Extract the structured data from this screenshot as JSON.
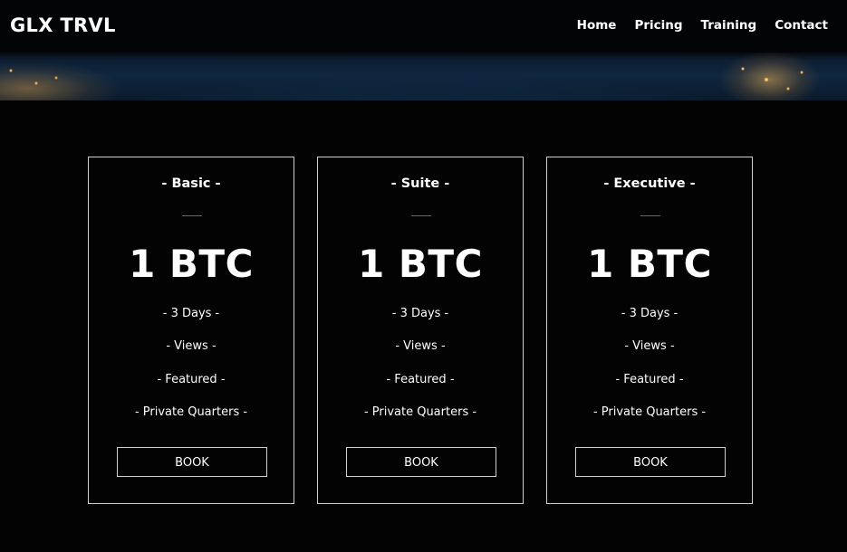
{
  "navbar": {
    "brand": "GLX TRVL",
    "links": [
      "Home",
      "Pricing",
      "Training",
      "Contact"
    ]
  },
  "plans": [
    {
      "title": "- Basic -",
      "price": "1 BTC",
      "features": [
        "- 3 Days -",
        "- Views -",
        "- Featured -",
        "- Private Quarters -"
      ],
      "button": "BOOK"
    },
    {
      "title": "- Suite -",
      "price": "1 BTC",
      "features": [
        "- 3 Days -",
        "- Views -",
        "- Featured -",
        "- Private Quarters -"
      ],
      "button": "BOOK"
    },
    {
      "title": "- Executive -",
      "price": "1 BTC",
      "features": [
        "- 3 Days -",
        "- Views -",
        "- Featured -",
        "- Private Quarters -"
      ],
      "button": "BOOK"
    }
  ]
}
